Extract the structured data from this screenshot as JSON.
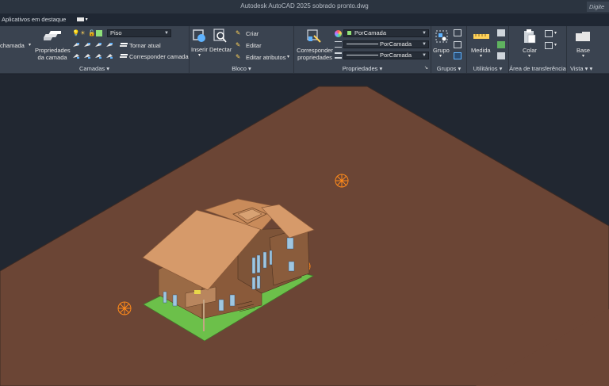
{
  "window": {
    "title": "Autodesk AutoCAD 2025    sobrado pronto.dwg",
    "search_placeholder": "Digite"
  },
  "tabs": {
    "featured": "Aplicativos em destaque"
  },
  "ribbon": {
    "layers_panel": {
      "left_cut_label": "chamada",
      "properties_button_line1": "Propriedades",
      "properties_button_line2": "da camada",
      "layer_combo_value": "Piso",
      "make_current": "Tornar atual",
      "match_layer": "Corresponder camada",
      "title": "Camadas"
    },
    "block_panel": {
      "insert": "Inserir",
      "detect": "Detectar",
      "create": "Criar",
      "edit": "Editar",
      "edit_attributes": "Editar atributos",
      "title": "Bloco"
    },
    "properties_panel": {
      "match_line1": "Corresponder",
      "match_line2": "propriedades",
      "color_value": "PorCamada",
      "linetype_value": "PorCamada",
      "lineweight_value": "PorCamada",
      "title": "Propriedades"
    },
    "groups_panel": {
      "group": "Grupo",
      "title": "Grupos"
    },
    "utilities_panel": {
      "measure": "Medida",
      "title": "Utilitários"
    },
    "clipboard_panel": {
      "paste": "Colar",
      "title": "Área de transferência"
    },
    "view_panel": {
      "base": "Base",
      "title": "Vista"
    }
  },
  "colors": {
    "ground": "#6b4535",
    "lawn": "#6cc04a",
    "roof": "#d69a6a",
    "walls": "#8a5a3a",
    "windows": "#9fc6e0",
    "marker": "#ff8a1a"
  }
}
